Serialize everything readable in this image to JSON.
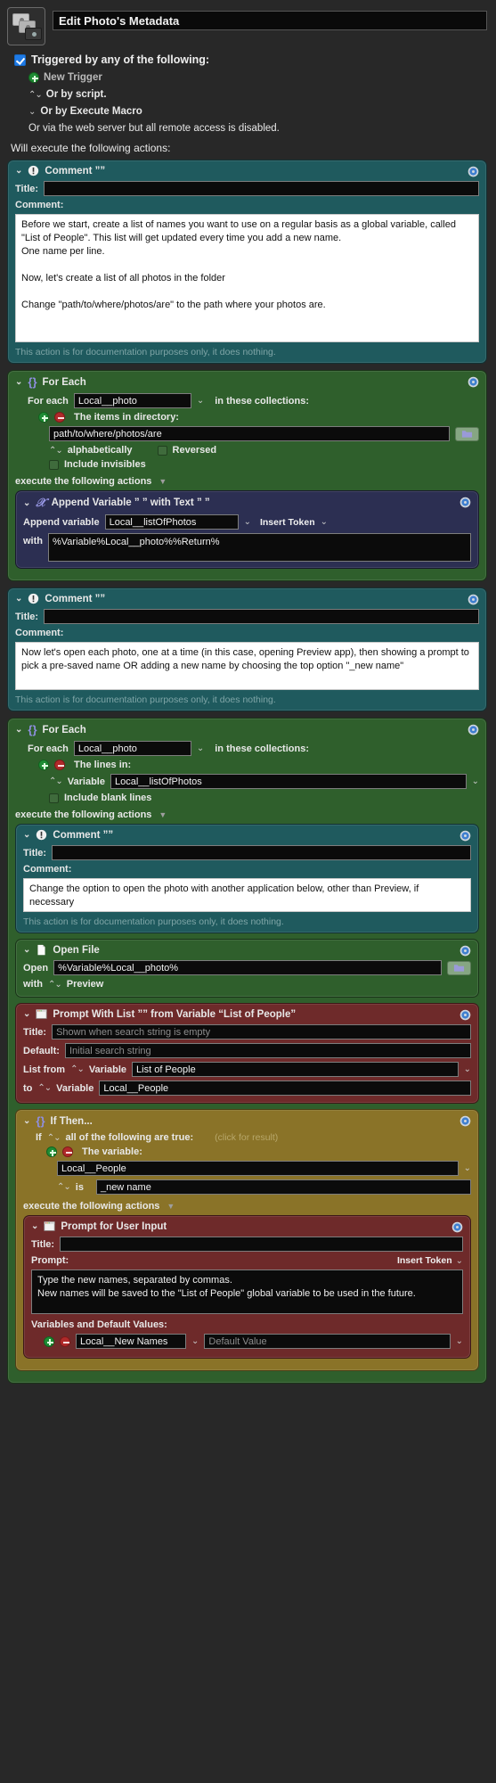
{
  "window": {
    "macro_title": "Edit Photo's Metadata",
    "macro_icon": "photo-stack-icon"
  },
  "triggers": {
    "checkbox_label": "Triggered by any of the following:",
    "new_trigger": "New Trigger",
    "or_by_script": "Or by script.",
    "or_by_execute_macro": "Or by Execute Macro",
    "web_server_note": "Or via the web server but all remote access is disabled."
  },
  "will_execute_label": "Will execute the following actions:",
  "labels": {
    "title": "Title:",
    "comment": "Comment:",
    "doc_note": "This action is for documentation purposes only, it does nothing.",
    "for_each": "For each",
    "in_these_collections": "in these collections:",
    "items_in_directory": "The items in directory:",
    "lines_in": "The lines in:",
    "alphabetically": "alphabetically",
    "reversed": "Reversed",
    "include_invisibles": "Include invisibles",
    "include_blank_lines": "Include blank lines",
    "execute_following": "execute the following actions",
    "append_variable": "Append variable",
    "with": "with",
    "insert_token": "Insert Token",
    "open": "Open",
    "with_app": "with",
    "default": "Default:",
    "list_from": "List from",
    "variable": "Variable",
    "to": "to",
    "if_all_true": "all of the following are true:",
    "if_prefix": "If",
    "click_for_result": "(click for result)",
    "the_variable": "The variable:",
    "is": "is",
    "prompt": "Prompt:",
    "variables_and_defaults": "Variables and Default Values:"
  },
  "actions": [
    {
      "type": "comment",
      "header": "Comment ””",
      "icon": "exclamation-circle-icon",
      "title_value": "",
      "body": "Before we start, create a list of names you want to use on a regular basis as a global variable, called \"List of People\". This list will get updated every time you add a new name.\nOne name per line.\n\nNow, let's create a list of all photos in the folder\n\nChange \"path/to/where/photos/are\" to the path where your photos are."
    },
    {
      "type": "foreach",
      "header": "For Each",
      "icon": "braces-icon",
      "variable": "Local__photo",
      "collection_kind": "The items in directory:",
      "path": "path/to/where/photos/are",
      "sort": "alphabetically",
      "reversed": false,
      "include_invisibles": false,
      "folder_button": "folder-picker-icon",
      "child": {
        "type": "append",
        "header": "Append Variable ” ” with Text ” ”",
        "icon": "variable-x-icon",
        "append_variable": "Local__listOfPhotos",
        "with_text": "%Variable%Local__photo%%Return%"
      }
    },
    {
      "type": "comment",
      "header": "Comment ””",
      "icon": "exclamation-circle-icon",
      "title_value": "",
      "body": "Now let's open each photo, one at a time (in this case, opening Preview app), then showing a prompt to pick a pre-saved name OR adding a new name by choosing the top option \"_new name\""
    },
    {
      "type": "foreach2",
      "header": "For Each",
      "icon": "braces-icon",
      "variable": "Local__photo",
      "collection_kind": "The lines in:",
      "source_kind": "Variable",
      "source_value": "Local__listOfPhotos",
      "include_blank_lines": false,
      "children": [
        {
          "type": "comment",
          "header": "Comment ””",
          "icon": "exclamation-circle-icon",
          "title_value": "",
          "body": "Change the option to open the photo with another application below, other than Preview, if necessary"
        },
        {
          "type": "openfile",
          "header": "Open File",
          "icon": "document-icon",
          "open_value": "%Variable%Local__photo%",
          "with_app": "Preview",
          "folder_button": "folder-picker-icon"
        },
        {
          "type": "promptwithlist",
          "header": "Prompt With List ”” from Variable “List of People”",
          "icon": "window-list-icon",
          "title_placeholder": "Shown when search string is empty",
          "default_placeholder": "Initial search string",
          "list_from_variable": "List of People",
          "to_variable": "Local__People"
        },
        {
          "type": "ifthen",
          "header": "If Then...",
          "icon": "braces-icon",
          "condition_variable": "Local__People",
          "condition_operator": "is",
          "condition_value": "_new name",
          "child": {
            "type": "userinput",
            "header": "Prompt for User Input",
            "icon": "window-list-icon",
            "title_value": "",
            "insert_token": "Insert Token",
            "prompt_body": "Type the new names, separated by commas.\nNew names will be saved to the \"List of People\" global variable to be used in the future.",
            "var_name": "Local__New Names",
            "var_default_placeholder": "Default Value"
          }
        }
      ]
    }
  ],
  "colors": {
    "bg": "#282828",
    "comment": "#1f5a5e",
    "foreach": "#2f5f2c",
    "append": "#2c2f52",
    "prompt": "#6e2a2a",
    "ifthen": "#8a7328",
    "accent_blue": "#1e7ae6",
    "plus_green": "#1f8c35",
    "minus_red": "#b02a2a"
  }
}
